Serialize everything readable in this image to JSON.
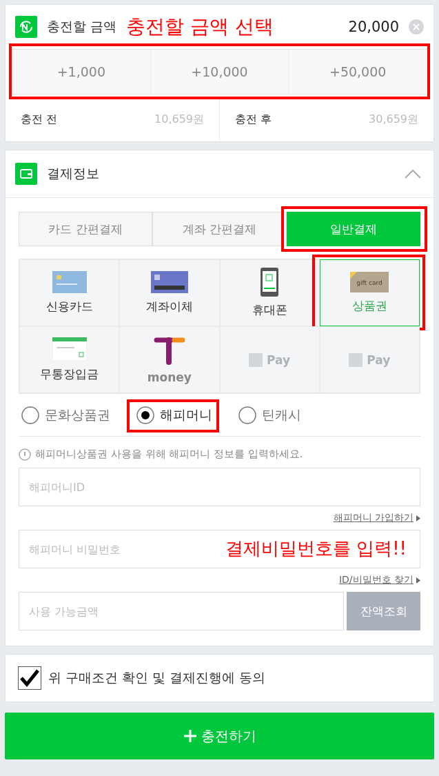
{
  "charge": {
    "title": "충전할 금액",
    "annotation": "충전할 금액 선택",
    "amount": "20,000",
    "quick": {
      "annotated": true,
      "buttons": [
        "+1,000",
        "+10,000",
        "+50,000"
      ]
    },
    "summary": [
      {
        "label": "충전 전",
        "value": "10,659원"
      },
      {
        "label": "충전 후",
        "value": "30,659원"
      }
    ]
  },
  "payment": {
    "title": "결제정보",
    "expanded": true,
    "tabs": [
      {
        "label": "카드 간편결제",
        "selected": false,
        "annotated": false
      },
      {
        "label": "계좌 간편결제",
        "selected": false,
        "annotated": false
      },
      {
        "label": "일반결제",
        "selected": true,
        "annotated": true
      }
    ],
    "methods": [
      {
        "kind": "credit-card",
        "label": "신용카드",
        "selected": false,
        "annotated": false
      },
      {
        "kind": "bank-transfer",
        "label": "계좌이체",
        "selected": false,
        "annotated": false
      },
      {
        "kind": "phone",
        "label": "휴대폰",
        "selected": false,
        "annotated": false
      },
      {
        "kind": "gift-card",
        "label": "상품권",
        "icon_text": "gift card",
        "selected": true,
        "annotated": true
      },
      {
        "kind": "deposit",
        "label": "무통장입금",
        "selected": false,
        "annotated": false
      },
      {
        "kind": "tmoney",
        "label": "money",
        "selected": false,
        "annotated": false
      },
      {
        "kind": "npay",
        "label": "Pay",
        "selected": false,
        "annotated": false
      },
      {
        "kind": "npay",
        "label": "Pay",
        "selected": false,
        "annotated": false
      }
    ],
    "radios": [
      {
        "label": "문화상품권",
        "selected": false,
        "annotated": false
      },
      {
        "label": "해피머니",
        "selected": true,
        "annotated": true
      },
      {
        "label": "틴캐시",
        "selected": false,
        "annotated": false
      }
    ],
    "notice": "해피머니상품권 사용을 위해 해피머니 정보를 입력하세요.",
    "id_field": {
      "placeholder": "해피머니ID"
    },
    "signup_link": "해피머니 가입하기",
    "password_field": {
      "placeholder": "해피머니 비밀번호",
      "annotation": "결제비밀번호를 입력!!"
    },
    "find_link": "ID/비밀번호 찾기",
    "balance_field": {
      "placeholder": "사용 가능금액"
    },
    "balance_button": {
      "label": "잔액조회",
      "disabled": true
    }
  },
  "agreement": {
    "label": "위 구매조건 확인 및 결제진행에 동의",
    "checked": true
  },
  "submit": {
    "label": "충전하기"
  }
}
